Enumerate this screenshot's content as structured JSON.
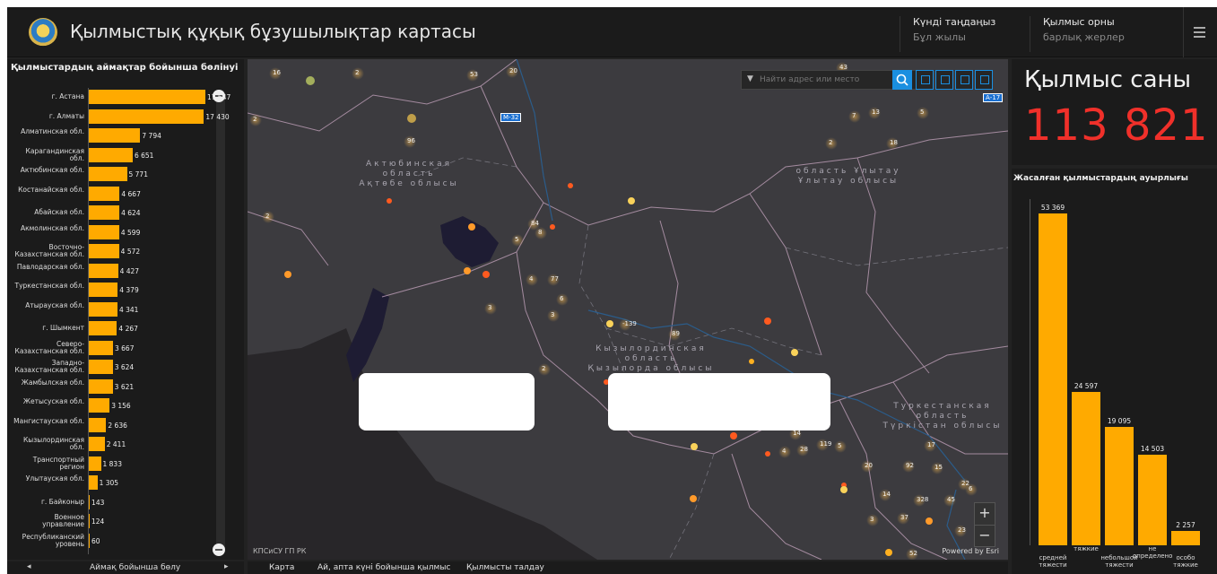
{
  "header": {
    "title": "Қылмыстық құқық бұзушылықтар картасы",
    "date_label": "Күнді таңдаңыз",
    "date_value": "Бұл жылы",
    "place_label": "Қылмыс орны",
    "place_value": "барлық жерлер"
  },
  "left_panel": {
    "title": "Қылмыстардың аймақтар бойынша бөлінуі",
    "footer_label": "Аймақ бойынша бөлу",
    "bars": [
      {
        "label": "г. Астана",
        "value": "17 647",
        "v": 17647
      },
      {
        "label": "г. Алматы",
        "value": "17 430",
        "v": 17430
      },
      {
        "label": "Алматинская обл.",
        "value": "7 794",
        "v": 7794
      },
      {
        "label": "Карагандинская обл.",
        "value": "6 651",
        "v": 6651
      },
      {
        "label": "Актюбинская обл.",
        "value": "5 771",
        "v": 5771
      },
      {
        "label": "Костанайская обл.",
        "value": "4 667",
        "v": 4667
      },
      {
        "label": "Абайская обл.",
        "value": "4 624",
        "v": 4624
      },
      {
        "label": "Акмолинская обл.",
        "value": "4 599",
        "v": 4599
      },
      {
        "label": "Восточно-Казахстанская обл.",
        "value": "4 572",
        "v": 4572
      },
      {
        "label": "Павлодарская обл.",
        "value": "4 427",
        "v": 4427
      },
      {
        "label": "Туркестанская обл.",
        "value": "4 379",
        "v": 4379
      },
      {
        "label": "Атырауская обл.",
        "value": "4 341",
        "v": 4341
      },
      {
        "label": "г. Шымкент",
        "value": "4 267",
        "v": 4267
      },
      {
        "label": "Северо-Казахстанская обл.",
        "value": "3 667",
        "v": 3667
      },
      {
        "label": "Западно-Казахстанская обл.",
        "value": "3 624",
        "v": 3624
      },
      {
        "label": "Жамбылская обл.",
        "value": "3 621",
        "v": 3621
      },
      {
        "label": "Жетысуская обл.",
        "value": "3 156",
        "v": 3156
      },
      {
        "label": "Мангистауская обл.",
        "value": "2 636",
        "v": 2636
      },
      {
        "label": "Кызылординская обл.",
        "value": "2 411",
        "v": 2411
      },
      {
        "label": "Транспортный регион",
        "value": "1 833",
        "v": 1833
      },
      {
        "label": "Улытауская обл.",
        "value": "1 305",
        "v": 1305
      },
      {
        "label": "г. Байконыр",
        "value": "143",
        "v": 143
      },
      {
        "label": "Военное управление",
        "value": "124",
        "v": 124
      },
      {
        "label": "Республиканский уровень",
        "value": "60",
        "v": 60
      }
    ]
  },
  "map": {
    "search_placeholder": "Найти адрес или место",
    "attribution": "КПСиСУ ГП РК",
    "powered": "Powered by Esri",
    "regions": {
      "aktobe": "Актюбинская\nобласть\nАқтөбе облысы",
      "ulytau": "область Ұлытау\nҰлытау облысы",
      "kyzylorda": "Кызылординская\nобласть\nҚызылорда облысы",
      "turkestan": "Туркестанская\nобласть\nТүркістан облысы"
    },
    "road_labels": [
      "М-32",
      "А-17"
    ],
    "cluster_labels": [
      "16",
      "2",
      "53",
      "20",
      "43",
      "96",
      "7",
      "13",
      "5",
      "2",
      "18",
      "2",
      "2",
      "84",
      "8",
      "5",
      "4",
      "77",
      "6",
      "3",
      "-139",
      "89",
      "2",
      "3",
      "2",
      "14",
      "28",
      "4",
      "119",
      "5",
      "20",
      "92",
      "17",
      "15",
      "22",
      "14",
      "328",
      "45",
      "6",
      "3",
      "37",
      "23",
      "52"
    ]
  },
  "tabs": [
    "Карта",
    "Ай, апта күні бойынша қылмыс",
    "Қылмысты талдау"
  ],
  "count_panel": {
    "title": "Қылмыс саны",
    "value": "113 821"
  },
  "severity": {
    "title": "Жасалған қылмыстардың ауырлығы",
    "bars": [
      {
        "category": "средней тяжести",
        "value": "53 369",
        "v": 53369
      },
      {
        "category": "тяжкие",
        "value": "24 597",
        "v": 24597
      },
      {
        "category": "небольшой тяжести",
        "value": "19 095",
        "v": 19095
      },
      {
        "category": "не определено",
        "value": "14 503",
        "v": 14503
      },
      {
        "category": "особо тяжкие",
        "value": "2 257",
        "v": 2257
      }
    ]
  },
  "colors": {
    "bar": "#ffaa00",
    "count": "#f0302a",
    "accent": "#1a8fe0"
  },
  "chart_data": [
    {
      "type": "bar",
      "title": "Қылмыстардың аймақтар бойынша бөлінуі",
      "categories": [
        "г. Астана",
        "г. Алматы",
        "Алматинская обл.",
        "Карагандинская обл.",
        "Актюбинская обл.",
        "Костанайская обл.",
        "Абайская обл.",
        "Акмолинская обл.",
        "Восточно-Казахстанская обл.",
        "Павлодарская обл.",
        "Туркестанская обл.",
        "Атырауская обл.",
        "г. Шымкент",
        "Северо-Казахстанская обл.",
        "Западно-Казахстанская обл.",
        "Жамбылская обл.",
        "Жетысуская обл.",
        "Мангистауская обл.",
        "Кызылординская обл.",
        "Транспортный регион",
        "Улытауская обл.",
        "г. Байконыр",
        "Военное управление",
        "Республиканский уровень"
      ],
      "values": [
        17647,
        17430,
        7794,
        6651,
        5771,
        4667,
        4624,
        4599,
        4572,
        4427,
        4379,
        4341,
        4267,
        3667,
        3624,
        3621,
        3156,
        2636,
        2411,
        1833,
        1305,
        143,
        124,
        60
      ],
      "orientation": "horizontal"
    },
    {
      "type": "bar",
      "title": "Жасалған қылмыстардың ауырлығы",
      "categories": [
        "средней тяжести",
        "тяжкие",
        "небольшой тяжести",
        "не определено",
        "особо тяжкие"
      ],
      "values": [
        53369,
        24597,
        19095,
        14503,
        2257
      ]
    }
  ]
}
